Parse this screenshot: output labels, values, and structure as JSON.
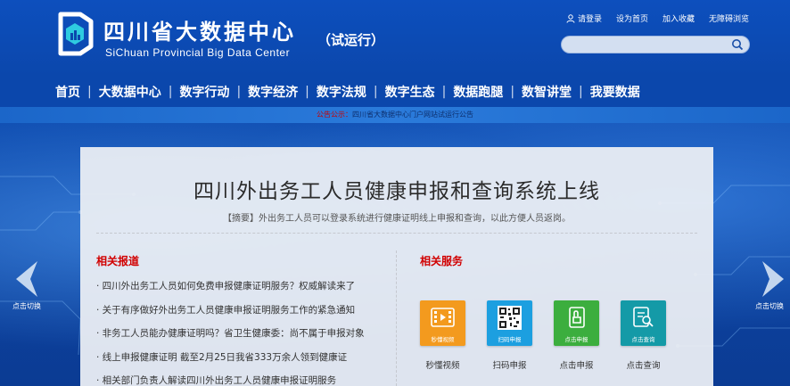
{
  "header": {
    "title": "四川省大数据中心",
    "subtitle": "SiChuan Provincial Big Data Center",
    "trial_tag": "（试运行）",
    "links": [
      {
        "label": "请登录",
        "icon": "user-icon"
      },
      {
        "label": "设为首页"
      },
      {
        "label": "加入收藏"
      },
      {
        "label": "无障碍浏览"
      }
    ],
    "search_placeholder": "",
    "brand_color": "#0b47ac"
  },
  "nav": {
    "items": [
      "首页",
      "大数据中心",
      "数字行动",
      "数字经济",
      "数字法规",
      "数字生态",
      "数据跑腿",
      "数智讲堂",
      "我要数据"
    ]
  },
  "notice": {
    "label": "公告公示：",
    "text": "四川省大数据中心门户网站试运行公告"
  },
  "carousel": {
    "prev_label": "点击切换",
    "next_label": "点击切换"
  },
  "article": {
    "title": "四川外出务工人员健康申报和查询系统上线",
    "summary": "【摘要】外出务工人员可以登录系统进行健康证明线上申报和查询，以此方便人员返岗。"
  },
  "related_news": {
    "heading": "相关报道",
    "items": [
      "· 四川外出务工人员如何免费申报健康证明服务？权威解读来了",
      "· 关于有序做好外出务工人员健康申报证明服务工作的紧急通知",
      "· 非务工人员能办健康证明吗？省卫生健康委：尚不属于申报对象",
      "· 线上申报健康证明 截至2月25日我省333万余人领到健康证",
      "· 相关部门负责人解读四川外出务工人员健康申报证明服务"
    ]
  },
  "related_services": {
    "heading": "相关服务",
    "items": [
      {
        "tile_text": "秒懂视频",
        "caption": "秒懂视频",
        "color": "#f39a1e",
        "icon": "video-icon"
      },
      {
        "tile_text": "扫码申报",
        "caption": "扫码申报",
        "color": "#1c9fe0",
        "icon": "qrcode-icon"
      },
      {
        "tile_text": "点击申报",
        "caption": "点击申报",
        "color": "#3cae3e",
        "icon": "declare-icon"
      },
      {
        "tile_text": "点击查询",
        "caption": "点击查询",
        "color": "#149aa7",
        "icon": "query-icon"
      }
    ]
  }
}
